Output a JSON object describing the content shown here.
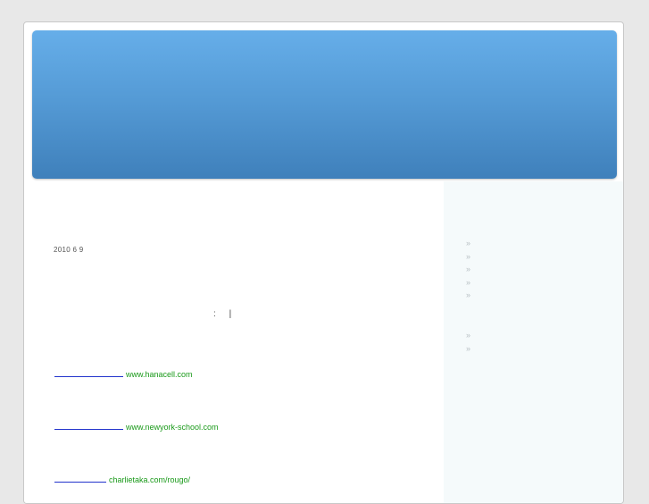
{
  "post": {
    "date": "2010 6 9",
    "meta_colon": ":",
    "meta_separator": "|"
  },
  "links": [
    {
      "url_text": "www.hanacell.com"
    },
    {
      "url_text": "www.newyork-school.com"
    },
    {
      "url_text": "charlietaka.com/rougo/"
    }
  ],
  "sidebar": {
    "list1": [
      "»",
      "»",
      "»",
      "»",
      "»"
    ],
    "list2": [
      "»",
      "»"
    ]
  },
  "colors": {
    "banner_top": "#66aee9",
    "banner_bottom": "#3f80bb",
    "link_green": "#1a9a1a",
    "link_blue": "#2233cc"
  }
}
